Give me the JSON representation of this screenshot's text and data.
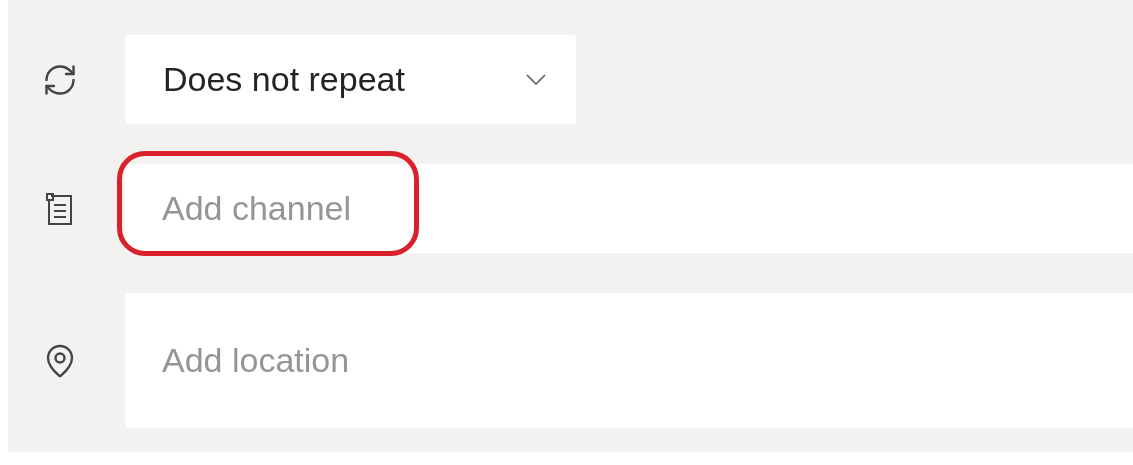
{
  "rows": [
    {
      "kind": "repeat",
      "value": "Does not repeat"
    },
    {
      "kind": "channel",
      "placeholder": "Add channel",
      "highlighted": true
    },
    {
      "kind": "location",
      "placeholder": "Add location",
      "highlighted": false
    }
  ]
}
